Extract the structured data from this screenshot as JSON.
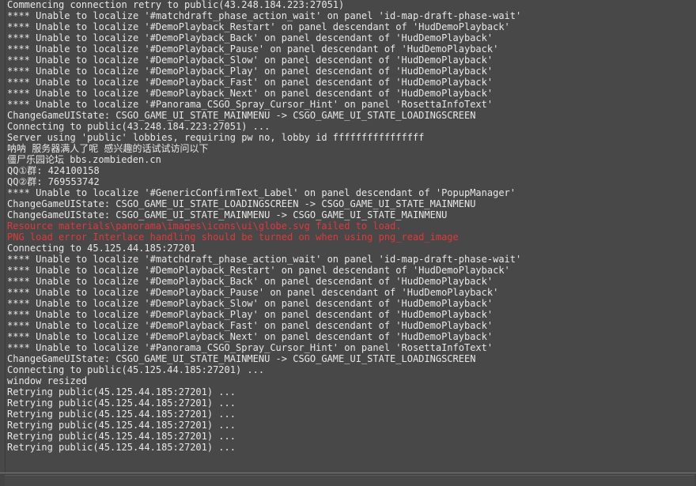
{
  "console": {
    "lines": [
      {
        "text": "Commencing connection retry to public(43.248.184.223:27051)",
        "type": "normal"
      },
      {
        "text": "**** Unable to localize '#matchdraft_phase_action_wait' on panel 'id-map-draft-phase-wait'",
        "type": "normal"
      },
      {
        "text": "**** Unable to localize '#DemoPlayback_Restart' on panel descendant of 'HudDemoPlayback'",
        "type": "normal"
      },
      {
        "text": "**** Unable to localize '#DemoPlayback_Back' on panel descendant of 'HudDemoPlayback'",
        "type": "normal"
      },
      {
        "text": "**** Unable to localize '#DemoPlayback_Pause' on panel descendant of 'HudDemoPlayback'",
        "type": "normal"
      },
      {
        "text": "**** Unable to localize '#DemoPlayback_Slow' on panel descendant of 'HudDemoPlayback'",
        "type": "normal"
      },
      {
        "text": "**** Unable to localize '#DemoPlayback_Play' on panel descendant of 'HudDemoPlayback'",
        "type": "normal"
      },
      {
        "text": "**** Unable to localize '#DemoPlayback_Fast' on panel descendant of 'HudDemoPlayback'",
        "type": "normal"
      },
      {
        "text": "**** Unable to localize '#DemoPlayback_Next' on panel descendant of 'HudDemoPlayback'",
        "type": "normal"
      },
      {
        "text": "**** Unable to localize '#Panorama_CSGO_Spray_Cursor_Hint' on panel 'RosettaInfoText'",
        "type": "normal"
      },
      {
        "text": "ChangeGameUIState: CSGO_GAME_UI_STATE_MAINMENU -> CSGO_GAME_UI_STATE_LOADINGSCREEN",
        "type": "normal"
      },
      {
        "text": "Connecting to public(43.248.184.223:27051) ...",
        "type": "normal"
      },
      {
        "text": "Server using 'public' lobbies, requiring pw no, lobby id ffffffffffffffff",
        "type": "normal"
      },
      {
        "text": "呐呐 服务器满人了呢 感兴趣的话试试访问以下",
        "type": "normal"
      },
      {
        "text": "僵尸乐园论坛 bbs.zombieden.cn",
        "type": "normal"
      },
      {
        "text": "QQ①群: 424100158",
        "type": "normal"
      },
      {
        "text": "QQ②群: 769553742",
        "type": "normal"
      },
      {
        "text": "**** Unable to localize '#GenericConfirmText_Label' on panel descendant of 'PopupManager'",
        "type": "normal"
      },
      {
        "text": "ChangeGameUIState: CSGO_GAME_UI_STATE_LOADINGSCREEN -> CSGO_GAME_UI_STATE_MAINMENU",
        "type": "normal"
      },
      {
        "text": "ChangeGameUIState: CSGO_GAME_UI_STATE_MAINMENU -> CSGO_GAME_UI_STATE_MAINMENU",
        "type": "normal"
      },
      {
        "text": "Resource materials\\panorama\\images\\icons\\ui\\globe.svg failed to load.",
        "type": "error"
      },
      {
        "text": "PNG load error Interlace handling should be turned on when using png_read_image",
        "type": "error"
      },
      {
        "text": "Connecting to 45.125.44.185:27201",
        "type": "normal"
      },
      {
        "text": "**** Unable to localize '#matchdraft_phase_action_wait' on panel 'id-map-draft-phase-wait'",
        "type": "normal"
      },
      {
        "text": "**** Unable to localize '#DemoPlayback_Restart' on panel descendant of 'HudDemoPlayback'",
        "type": "normal"
      },
      {
        "text": "**** Unable to localize '#DemoPlayback_Back' on panel descendant of 'HudDemoPlayback'",
        "type": "normal"
      },
      {
        "text": "**** Unable to localize '#DemoPlayback_Pause' on panel descendant of 'HudDemoPlayback'",
        "type": "normal"
      },
      {
        "text": "**** Unable to localize '#DemoPlayback_Slow' on panel descendant of 'HudDemoPlayback'",
        "type": "normal"
      },
      {
        "text": "**** Unable to localize '#DemoPlayback_Play' on panel descendant of 'HudDemoPlayback'",
        "type": "normal"
      },
      {
        "text": "**** Unable to localize '#DemoPlayback_Fast' on panel descendant of 'HudDemoPlayback'",
        "type": "normal"
      },
      {
        "text": "**** Unable to localize '#DemoPlayback_Next' on panel descendant of 'HudDemoPlayback'",
        "type": "normal"
      },
      {
        "text": "**** Unable to localize '#Panorama_CSGO_Spray_Cursor_Hint' on panel 'RosettaInfoText'",
        "type": "normal"
      },
      {
        "text": "ChangeGameUIState: CSGO_GAME_UI_STATE_MAINMENU -> CSGO_GAME_UI_STATE_LOADINGSCREEN",
        "type": "normal"
      },
      {
        "text": "Connecting to public(45.125.44.185:27201) ...",
        "type": "normal"
      },
      {
        "text": "window resized",
        "type": "normal"
      },
      {
        "text": "Retrying public(45.125.44.185:27201) ...",
        "type": "normal"
      },
      {
        "text": "Retrying public(45.125.44.185:27201) ...",
        "type": "normal"
      },
      {
        "text": "Retrying public(45.125.44.185:27201) ...",
        "type": "normal"
      },
      {
        "text": "Retrying public(45.125.44.185:27201) ...",
        "type": "normal"
      },
      {
        "text": "Retrying public(45.125.44.185:27201) ...",
        "type": "normal"
      },
      {
        "text": "Retrying public(45.125.44.185:27201) ...",
        "type": "normal"
      }
    ],
    "input": {
      "value": ""
    }
  },
  "colors": {
    "background": "#484848",
    "text": "#e8e8e8",
    "error": "#e0383b"
  }
}
